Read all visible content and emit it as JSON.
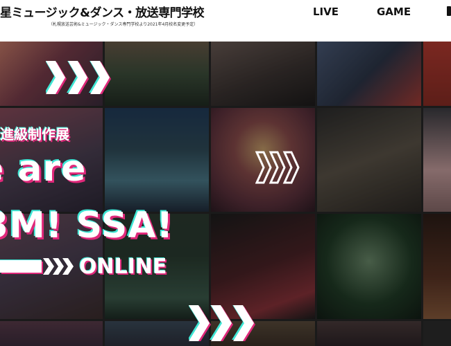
{
  "header": {
    "logo_main": "星ミュージック&ダンス・放送専門学校",
    "logo_sub": "（札幌放送芸術&ミュージック・ダンス専門学校より2021年4月校名変更予定）",
    "nav": [
      "LIVE",
      "GAME"
    ]
  },
  "hero": {
    "exhibition": "進級制作展",
    "headline_1": "e are",
    "headline_2": "3M! SSA!",
    "online": "ONLINE"
  },
  "tiles": [
    {
      "name": "tile-anime-illustration",
      "color": "#7a3b4a"
    },
    {
      "name": "tile-chorus-stage",
      "color": "#3c4e3a"
    },
    {
      "name": "tile-band-live",
      "color": "#3a3230"
    },
    {
      "name": "tile-gamer-closeup",
      "color": "#2a3447"
    },
    {
      "name": "tile-edge-red",
      "color": "#8a2a22"
    },
    {
      "name": "tile-esports-arena",
      "color": "#2d4a58"
    },
    {
      "name": "tile-singer-pink-stage",
      "color": "#5a2e3a"
    },
    {
      "name": "tile-actors-costume",
      "color": "#3a3a3a"
    },
    {
      "name": "tile-edge-sign",
      "color": "#2a2a2a"
    },
    {
      "name": "tile-anime-characters",
      "color": "#4a3e52"
    },
    {
      "name": "tile-game-controllers",
      "color": "#273a2e"
    },
    {
      "name": "tile-dancer-red-skirt",
      "color": "#4a2024"
    },
    {
      "name": "tile-singer-green-stage",
      "color": "#1e3a24"
    },
    {
      "name": "tile-edge-portrait",
      "color": "#5a3222"
    },
    {
      "name": "tile-bottom-crowd",
      "color": "#3a2a3a"
    },
    {
      "name": "tile-bottom-stage",
      "color": "#2a2e3a"
    },
    {
      "name": "tile-bottom-band",
      "color": "#3a2e24"
    },
    {
      "name": "tile-bottom-show",
      "color": "#2a2024"
    },
    {
      "name": "tile-bottom-edge",
      "color": "#2a2a2a"
    }
  ],
  "colors": {
    "glitch_pink": "#e0287a",
    "glitch_cyan": "#3ee6d4",
    "chevron": "#ffffff"
  },
  "icons": [
    "triple-chevron-icon",
    "arrow-bar-icon"
  ]
}
